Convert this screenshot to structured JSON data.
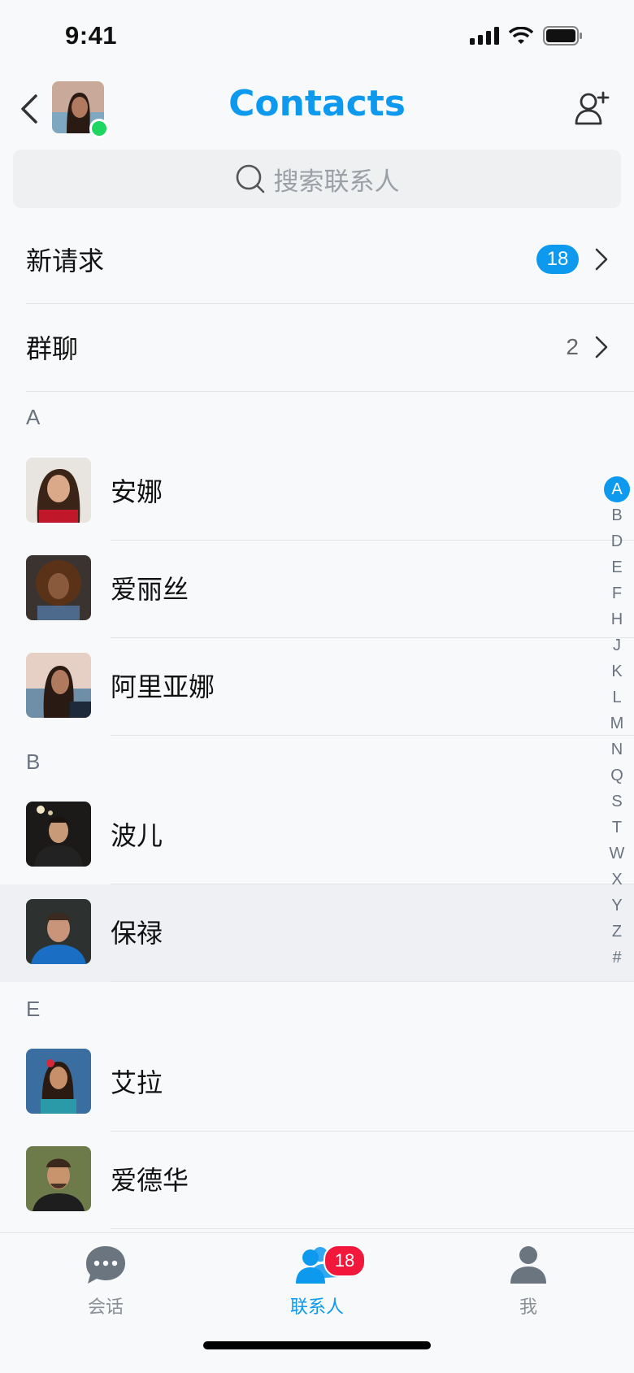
{
  "status_bar": {
    "time": "9:41"
  },
  "header": {
    "title": "Contacts"
  },
  "search": {
    "placeholder": "搜索联系人"
  },
  "menu": {
    "new_requests": {
      "label": "新请求",
      "badge": "18"
    },
    "group_chats": {
      "label": "群聊",
      "count": "2"
    }
  },
  "sections": [
    {
      "letter": "A",
      "contacts": [
        {
          "name": "安娜"
        },
        {
          "name": "爱丽丝"
        },
        {
          "name": "阿里亚娜"
        }
      ]
    },
    {
      "letter": "B",
      "contacts": [
        {
          "name": "波儿"
        },
        {
          "name": "保禄"
        }
      ]
    },
    {
      "letter": "E",
      "contacts": [
        {
          "name": "艾拉"
        },
        {
          "name": "爱德华"
        }
      ]
    }
  ],
  "index_letters": [
    "A",
    "B",
    "D",
    "E",
    "F",
    "H",
    "J",
    "K",
    "L",
    "M",
    "N",
    "Q",
    "S",
    "T",
    "W",
    "X",
    "Y",
    "Z",
    "#"
  ],
  "index_active": "A",
  "tabbar": {
    "tabs": [
      {
        "label": "会话",
        "icon": "chat-bubble-icon"
      },
      {
        "label": "联系人",
        "icon": "contacts-icon",
        "badge": "18"
      },
      {
        "label": "我",
        "icon": "person-icon"
      }
    ]
  },
  "colors": {
    "accent": "#0d99ee",
    "badge_red": "#f2183b",
    "online": "#1ed760"
  }
}
